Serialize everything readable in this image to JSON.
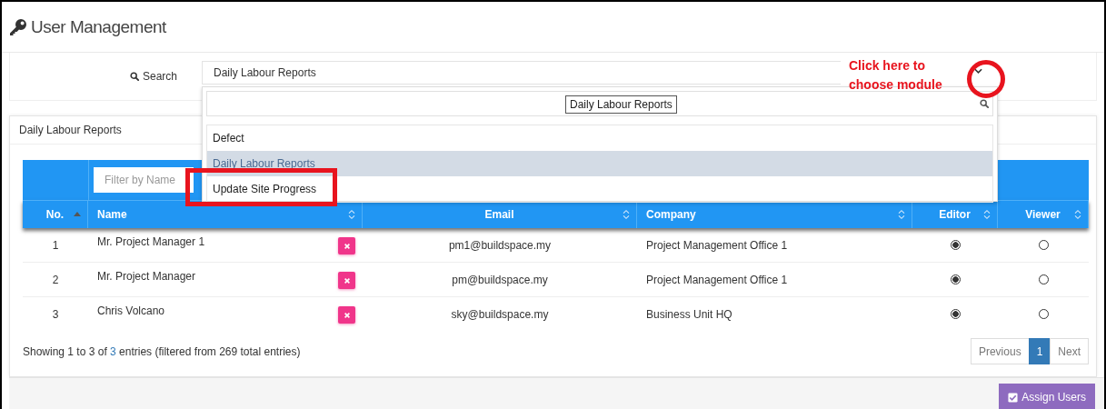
{
  "page": {
    "title": "User Management"
  },
  "search": {
    "label": "Search",
    "value": "Daily Labour Reports"
  },
  "dropdown": {
    "tooltip": "Daily Labour Reports",
    "options": [
      {
        "label": "Defect",
        "selected": false
      },
      {
        "label": "Daily Labour Reports",
        "selected": true
      },
      {
        "label": "Update Site Progress",
        "selected": false
      }
    ]
  },
  "annotation": {
    "text_lines": [
      "Click here to",
      "choose module"
    ]
  },
  "card": {
    "title": "Daily Labour Reports"
  },
  "table": {
    "filter_placeholder": "Filter by Name",
    "columns": [
      {
        "label": "No.",
        "sorted": true
      },
      {
        "label": "Name",
        "sorted": false
      },
      {
        "label": "Email",
        "sorted": false
      },
      {
        "label": "Company",
        "sorted": false
      },
      {
        "label": "Editor",
        "sorted": false
      },
      {
        "label": "Viewer",
        "sorted": false
      }
    ],
    "rows": [
      {
        "no": "1",
        "name": "Mr. Project Manager 1",
        "email": "pm1@buildspace.my",
        "company": "Project Management Office 1",
        "editor": true,
        "viewer": false
      },
      {
        "no": "2",
        "name": "Mr. Project Manager",
        "email": "pm@buildspace.my",
        "company": "Project Management Office 1",
        "editor": true,
        "viewer": false
      },
      {
        "no": "3",
        "name": "Chris Volcano",
        "email": "sky@buildspace.my",
        "company": "Business Unit HQ",
        "editor": true,
        "viewer": false
      }
    ]
  },
  "info": {
    "before": "Showing 1 to 3 of",
    "link": "3",
    "after": "entries (filtered from 269 total entries)"
  },
  "pagination": [
    {
      "label": "Previous",
      "selected": false
    },
    {
      "label": "1",
      "selected": true
    },
    {
      "label": "Next",
      "selected": false
    }
  ],
  "footer": {
    "button": "Assign Users"
  }
}
